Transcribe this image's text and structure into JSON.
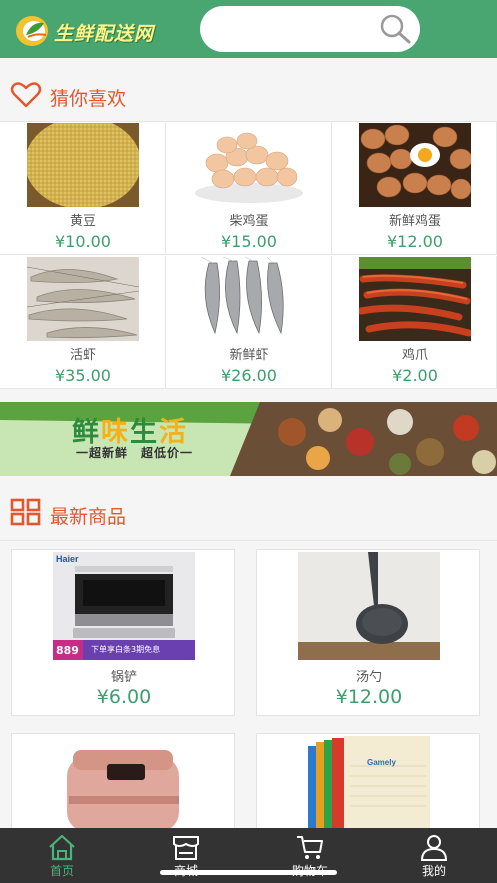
{
  "header": {
    "logo_text": "生鲜配送网",
    "search_placeholder": ""
  },
  "guess": {
    "title": "猜你喜欢",
    "items": [
      {
        "name": "黄豆",
        "price": "¥10.00",
        "image": "soybean"
      },
      {
        "name": "柴鸡蛋",
        "price": "¥15.00",
        "image": "eggs"
      },
      {
        "name": "新鲜鸡蛋",
        "price": "¥12.00",
        "image": "eggs-basket"
      },
      {
        "name": "活虾",
        "price": "¥35.00",
        "image": "shrimp-pile"
      },
      {
        "name": "新鲜虾",
        "price": "¥26.00",
        "image": "shrimp-row"
      },
      {
        "name": "鸡爪",
        "price": "¥2.00",
        "image": "chicken-feet"
      }
    ]
  },
  "banner": {
    "main_1": "鲜",
    "main_2": "味",
    "main_3": "生",
    "main_4": "活",
    "sub": "一超新鲜　超低价一"
  },
  "latest": {
    "title": "最新商品",
    "items": [
      {
        "name": "锅铲",
        "price": "¥6.00",
        "image": "range-hood",
        "brand": "Haier",
        "badge": "889",
        "promo": "下单享白条3期免息"
      },
      {
        "name": "汤勺",
        "price": "¥12.00",
        "image": "ladle"
      },
      {
        "name": "",
        "price": "",
        "image": "rice-cooker"
      },
      {
        "name": "",
        "price": "",
        "image": "notebooks",
        "brand": "Gamely"
      }
    ]
  },
  "tabs": [
    {
      "label": "首页",
      "icon": "home-icon",
      "active": true
    },
    {
      "label": "商城",
      "icon": "store-icon",
      "active": false
    },
    {
      "label": "购物车",
      "icon": "cart-icon",
      "active": false
    },
    {
      "label": "我的",
      "icon": "user-icon",
      "active": false
    }
  ],
  "colors": {
    "header_green": "#4aa671",
    "accent_orange": "#e4572e",
    "price_green": "#3e9e6c",
    "tabbar": "#333333"
  }
}
